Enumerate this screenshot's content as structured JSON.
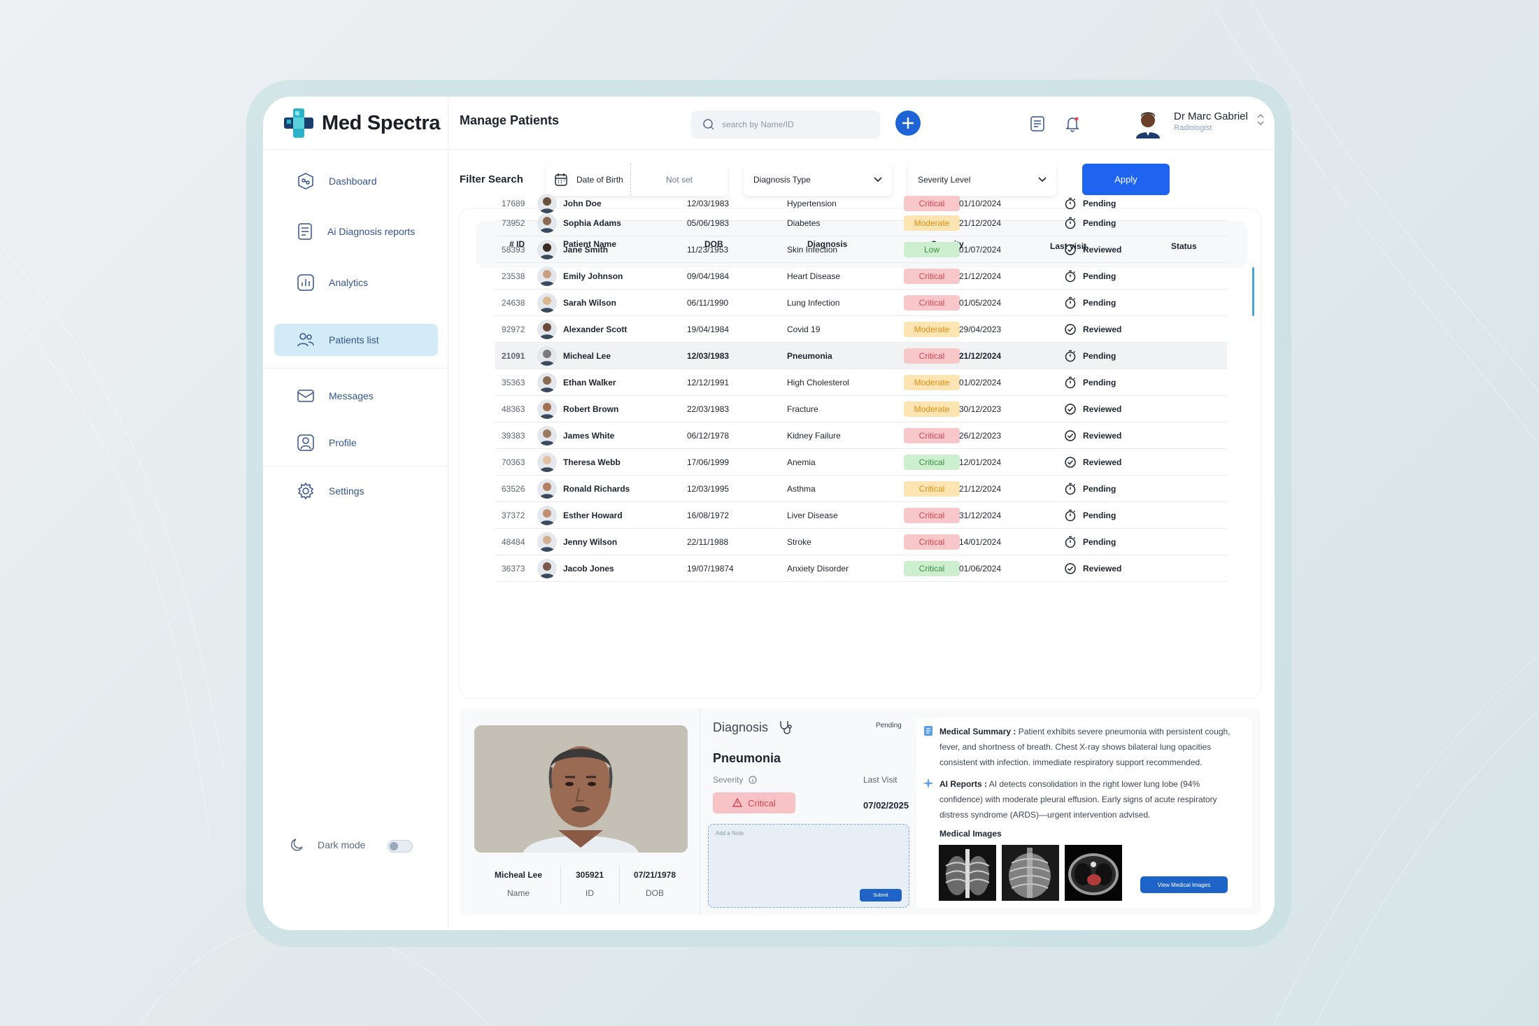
{
  "brand": {
    "name": "Med Spectra",
    "colors": {
      "accent": "#1e64f0",
      "logo_teal": "#2bb3c9",
      "logo_navy": "#1a3f6e"
    }
  },
  "header": {
    "title": "Manage Patients",
    "search_placeholder": "search by Name/ID",
    "user": {
      "name": "Dr Marc Gabriel",
      "role": "Radiologist"
    }
  },
  "sidebar": {
    "items": [
      {
        "label": "Dashboard",
        "icon": "dashboard-icon",
        "active": false
      },
      {
        "label": "Ai Diagnosis reports",
        "icon": "report-icon",
        "active": false
      },
      {
        "label": "Analytics",
        "icon": "analytics-icon",
        "active": false
      },
      {
        "label": "Patients list",
        "icon": "users-icon",
        "active": true
      },
      {
        "label": "Messages",
        "icon": "mail-icon",
        "active": false
      },
      {
        "label": "Profile",
        "icon": "profile-icon",
        "active": false
      },
      {
        "label": "Settings",
        "icon": "gear-icon",
        "active": false
      }
    ],
    "dark_mode_label": "Dark mode"
  },
  "filter": {
    "label": "Filter Search",
    "dob_label": "Date of Birth",
    "dob_value": "Not set",
    "diagnosis_type": "Diagnosis Type",
    "severity_level": "Severity Level",
    "apply": "Apply"
  },
  "table": {
    "columns": [
      "# ID",
      "Patient Name",
      "DOB",
      "Diagnosis",
      "Severity",
      "Last visit",
      "Status"
    ],
    "rows": [
      {
        "id": "17689",
        "name": "John Doe",
        "dob": "12/03/1983",
        "diagnosis": "Hypertension",
        "severity": "Critical",
        "sev_style": "critical",
        "last_visit": "01/10/2024",
        "status": "Pending"
      },
      {
        "id": "73952",
        "name": "Sophia Adams",
        "dob": "05/06/1983",
        "diagnosis": "Diabetes",
        "severity": "Moderate",
        "sev_style": "moderate",
        "last_visit": "21/12/2024",
        "status": "Pending"
      },
      {
        "id": "58393",
        "name": "Jane Smith",
        "dob": "11/23/1953",
        "diagnosis": "Skin Infection",
        "severity": "Low",
        "sev_style": "low",
        "last_visit": "01/07/2024",
        "status": "Reviewed"
      },
      {
        "id": "23538",
        "name": "Emily Johnson",
        "dob": "09/04/1984",
        "diagnosis": "Heart Disease",
        "severity": "Critical",
        "sev_style": "critical",
        "last_visit": "21/12/2024",
        "status": "Pending"
      },
      {
        "id": "24638",
        "name": "Sarah Wilson",
        "dob": "06/11/1990",
        "diagnosis": "Lung Infection",
        "severity": "Critical",
        "sev_style": "critical",
        "last_visit": "01/05/2024",
        "status": "Pending"
      },
      {
        "id": "92972",
        "name": "Alexander Scott",
        "dob": "19/04/1984",
        "diagnosis": "Covid 19",
        "severity": "Moderate",
        "sev_style": "moderate",
        "last_visit": "29/04/2023",
        "status": "Reviewed"
      },
      {
        "id": "21091",
        "name": "Micheal Lee",
        "dob": "12/03/1983",
        "diagnosis": "Pneumonia",
        "severity": "Critical",
        "sev_style": "critical",
        "last_visit": "21/12/2024",
        "status": "Pending",
        "selected": true
      },
      {
        "id": "35363",
        "name": "Ethan Walker",
        "dob": "12/12/1991",
        "diagnosis": "High Cholesterol",
        "severity": "Moderate",
        "sev_style": "moderate",
        "last_visit": "01/02/2024",
        "status": "Pending"
      },
      {
        "id": "48363",
        "name": "Robert Brown",
        "dob": "22/03/1983",
        "diagnosis": "Fracture",
        "severity": "Moderate",
        "sev_style": "moderate",
        "last_visit": "30/12/2023",
        "status": "Reviewed"
      },
      {
        "id": "39383",
        "name": "James White",
        "dob": "06/12/1978",
        "diagnosis": "Kidney Failure",
        "severity": "Critical",
        "sev_style": "critical",
        "last_visit": "26/12/2023",
        "status": "Reviewed"
      },
      {
        "id": "70363",
        "name": "Theresa Webb",
        "dob": "17/06/1999",
        "diagnosis": "Anemia",
        "severity": "Critical",
        "sev_style": "green",
        "last_visit": "12/01/2024",
        "status": "Reviewed"
      },
      {
        "id": "63526",
        "name": "Ronald Richards",
        "dob": "12/03/1995",
        "diagnosis": "Asthma",
        "severity": "Critical",
        "sev_style": "amber",
        "last_visit": "21/12/2024",
        "status": "Pending"
      },
      {
        "id": "37372",
        "name": "Esther Howard",
        "dob": "16/08/1972",
        "diagnosis": "Liver Disease",
        "severity": "Critical",
        "sev_style": "critical",
        "last_visit": "31/12/2024",
        "status": "Pending"
      },
      {
        "id": "48484",
        "name": "Jenny Wilson",
        "dob": "22/11/1988",
        "diagnosis": "Stroke",
        "severity": "Critical",
        "sev_style": "critical",
        "last_visit": "14/01/2024",
        "status": "Pending"
      },
      {
        "id": "36373",
        "name": "Jacob Jones",
        "dob": "19/07/19874",
        "diagnosis": "Anxiety Disorder",
        "severity": "Critical",
        "sev_style": "green",
        "last_visit": "01/06/2024",
        "status": "Reviewed"
      }
    ]
  },
  "detail": {
    "name": "Micheal Lee",
    "name_label": "Name",
    "id": "305921",
    "id_label": "ID",
    "dob": "07/21/1978",
    "dob_label": "DOB",
    "diagnosis_heading": "Diagnosis",
    "status": "Pending",
    "diagnosis": "Pneumonia",
    "severity_label": "Severity",
    "severity": "Critical",
    "last_visit_label": "Last Visit",
    "last_visit": "07/02/2025",
    "note_placeholder": "Add a Note",
    "submit": "Submit",
    "summary_title": "Medical Summary :",
    "summary_text": "Patient exhibits severe pneumonia with persistent cough, fever, and shortness of breath. Chest X-ray shows bilateral lung opacities consistent with infection.  immediate respiratory support recommended.",
    "ai_title": "AI Reports :",
    "ai_text": "AI detects consolidation in the right lower lung lobe (94% confidence) with moderate pleural effusion. Early signs of acute respiratory distress syndrome (ARDS)—urgent intervention advised.",
    "images_label": "Medical Images",
    "view_images": "View Medical Images"
  }
}
